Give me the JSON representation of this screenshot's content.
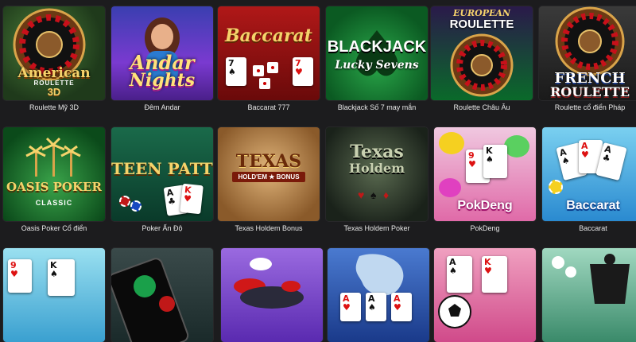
{
  "games": [
    {
      "caption": "Roulette Mỹ 3D",
      "logo_line1": "American",
      "logo_line2": "ROULETTE",
      "logo_line3": "3D"
    },
    {
      "caption": "Đêm Andar",
      "logo_line1": "Andar",
      "logo_line2": "Nights"
    },
    {
      "caption": "Baccarat 777",
      "logo_line1": "Baccarat"
    },
    {
      "caption": "Blackjack Số 7 may mắn",
      "logo_line1": "BLACKJACK",
      "logo_line2": "Lucky Sevens"
    },
    {
      "caption": "Roulette Châu Âu",
      "logo_line1": "EUROPEAN",
      "logo_line2": "ROULETTE"
    },
    {
      "caption": "Roulette cổ điển Pháp",
      "logo_line1": "FRENCH",
      "logo_line2": "ROULETTE"
    },
    {
      "caption": "Oasis Poker Cổ điển",
      "logo_line1": "OASIS POKER",
      "logo_line2": "CLASSIC"
    },
    {
      "caption": "Poker Ấn Độ",
      "logo_line1": "TEEN PATTI"
    },
    {
      "caption": "Texas Holdem Bonus",
      "logo_line1": "TEXAS",
      "logo_line2": "HOLD'EM ★ BONUS"
    },
    {
      "caption": "Texas Holdem Poker",
      "logo_line1": "Texas",
      "logo_line2": "Holdem"
    },
    {
      "caption": "PokDeng",
      "logo_line1": "PokDeng"
    },
    {
      "caption": "Baccarat",
      "logo_line1": "Baccarat"
    },
    {
      "caption": ""
    },
    {
      "caption": ""
    },
    {
      "caption": ""
    },
    {
      "caption": ""
    },
    {
      "caption": ""
    },
    {
      "caption": ""
    }
  ],
  "cards": {
    "c7a": "7",
    "c7b": "7",
    "c7s": "♠",
    "c7h": "♥",
    "c9": "9",
    "ck": "K",
    "ca": "A",
    "cheart": "♥",
    "cspade": "♠",
    "cclub": "♣"
  },
  "colors": {
    "background": "#1c1c1e",
    "caption_text": "#e6e6e6"
  }
}
